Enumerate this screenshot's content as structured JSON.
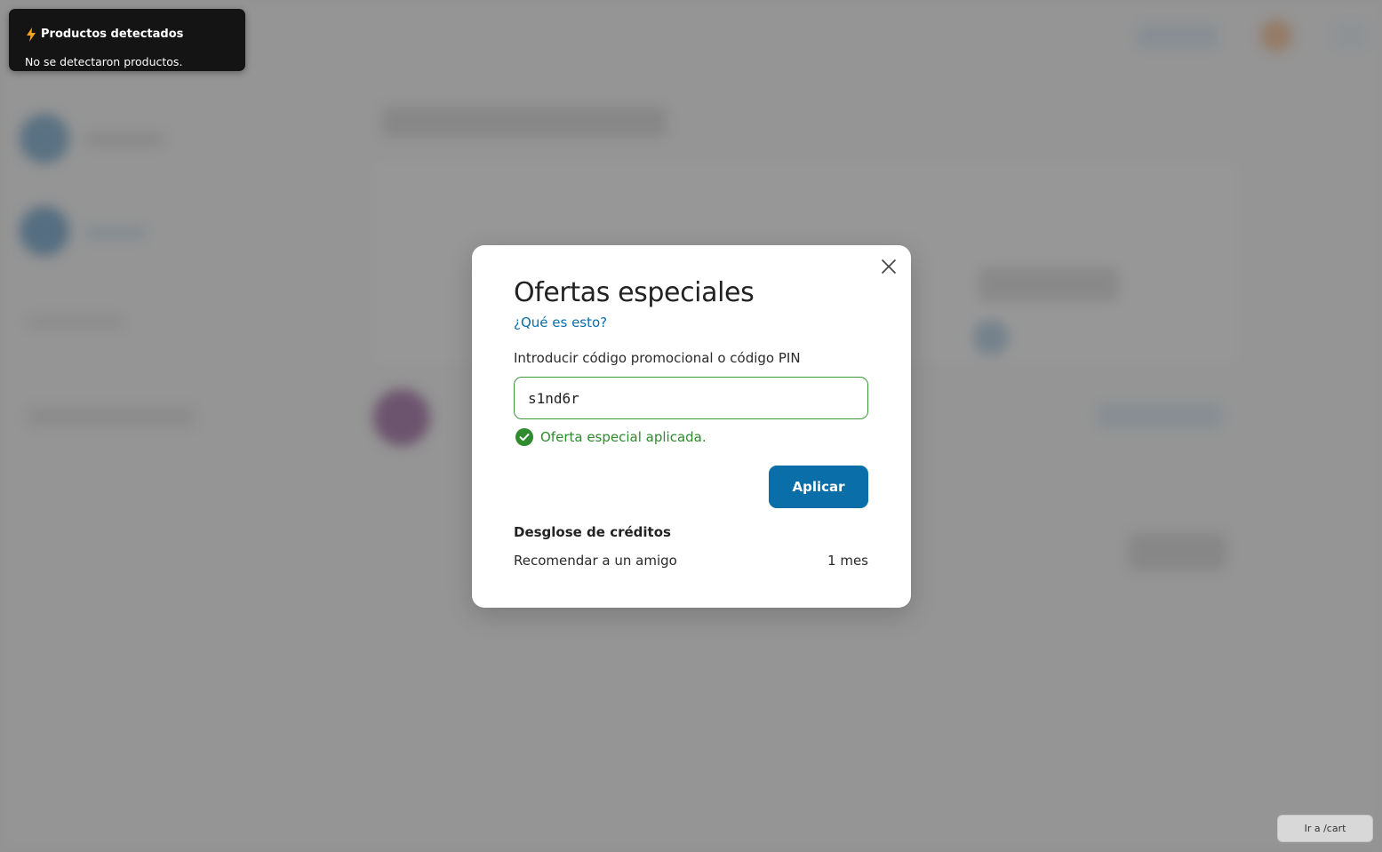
{
  "toast": {
    "icon": "lightning-icon",
    "title": "Productos detectados",
    "message": "No se detectaron productos."
  },
  "modal": {
    "title": "Ofertas especiales",
    "help_link": "¿Qué es esto?",
    "field_label": "Introducir código promocional o código PIN",
    "promo_code_value": "s1nd6r",
    "success_message": "Oferta especial aplicada.",
    "apply_label": "Aplicar",
    "breakdown_title": "Desglose de créditos",
    "credits": [
      {
        "label": "Recomendar a un amigo",
        "value": "1 mes"
      }
    ],
    "close_icon": "close-icon"
  },
  "cart_button": {
    "label": "Ir a /cart"
  },
  "colors": {
    "accent": "#0a6ea8",
    "success": "#2e8b2e",
    "toast_bg": "#141414",
    "toast_icon": "#f5a524"
  }
}
